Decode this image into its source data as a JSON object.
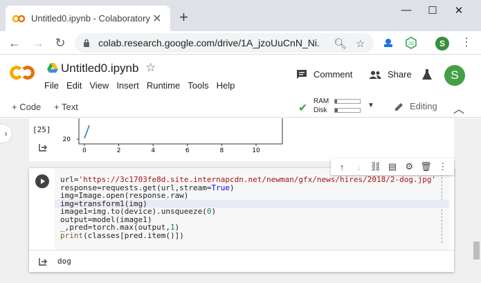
{
  "browser": {
    "tab_title": "Untitled0.ipynb - Colaboratory",
    "url": "colab.research.google.com/drive/1A_jzoUuCnN_Ni...",
    "profile_initial": "S"
  },
  "colab": {
    "notebook_title": "Untitled0.ipynb",
    "menu": [
      "File",
      "Edit",
      "View",
      "Insert",
      "Runtime",
      "Tools",
      "Help"
    ],
    "comment_label": "Comment",
    "share_label": "Share",
    "user_initial": "S",
    "toolbar": {
      "add_code": "+ Code",
      "add_text": "+ Text",
      "ram_label": "RAM",
      "disk_label": "Disk",
      "ram_usage": 0.08,
      "disk_usage": 0.12,
      "mode_label": "Editing"
    }
  },
  "prev_cell": {
    "exec_count": "[25]",
    "plot": {
      "y_tick": "20",
      "x_ticks": [
        "0",
        "2",
        "4",
        "6",
        "8",
        "10"
      ]
    }
  },
  "cell": {
    "code_lines": [
      {
        "parts": [
          [
            "",
            "url="
          ],
          [
            "str",
            "'https://3c1703fe8d.site.internapcdn.net/newman/gfx/news/hires/2018/2-dog.jpg'"
          ]
        ]
      },
      {
        "parts": [
          [
            "",
            "response=requests.get(url,stream="
          ],
          [
            "const",
            "True"
          ],
          [
            "",
            ")"
          ]
        ]
      },
      {
        "parts": [
          [
            "",
            "img=Image.open(response.raw)"
          ]
        ]
      },
      {
        "parts": [
          [
            "",
            "img=transform1(img)"
          ]
        ]
      },
      {
        "parts": [
          [
            "",
            "image1=img.to(device).unsqueeze("
          ],
          [
            "num",
            "0"
          ],
          [
            "",
            ")"
          ]
        ]
      },
      {
        "parts": [
          [
            "",
            "output=model(image1)"
          ]
        ]
      },
      {
        "parts": [
          [
            "",
            "_,pred=torch.max(output,"
          ],
          [
            "num",
            "1"
          ],
          [
            "",
            ")"
          ]
        ]
      },
      {
        "parts": [
          [
            "fn",
            "print"
          ],
          [
            "",
            "(classes[pred.item()])"
          ]
        ]
      }
    ],
    "active_line": 3,
    "output_text": "dog"
  }
}
